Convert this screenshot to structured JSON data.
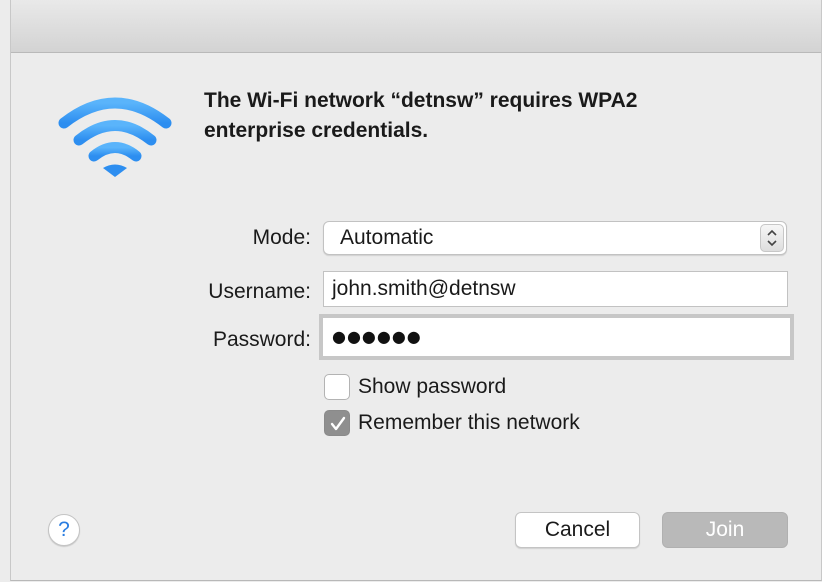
{
  "dialog": {
    "message_line1": "The Wi-Fi network “detnsw” requires WPA2",
    "message_line2": "enterprise credentials.",
    "icon": "wifi-icon"
  },
  "form": {
    "mode_label": "Mode:",
    "mode_value": "Automatic",
    "username_label": "Username:",
    "username_value": "john.smith@detnsw",
    "password_label": "Password:",
    "password_masked": "●●●●●●"
  },
  "options": {
    "show_password_label": "Show password",
    "show_password_checked": false,
    "remember_label": "Remember this network",
    "remember_checked": true
  },
  "buttons": {
    "help": "?",
    "cancel": "Cancel",
    "join": "Join",
    "join_enabled": false
  },
  "colors": {
    "wifi_blue": "#3d9cf5",
    "help_blue": "#2a7de1",
    "join_disabled": "#b9b9b9"
  }
}
